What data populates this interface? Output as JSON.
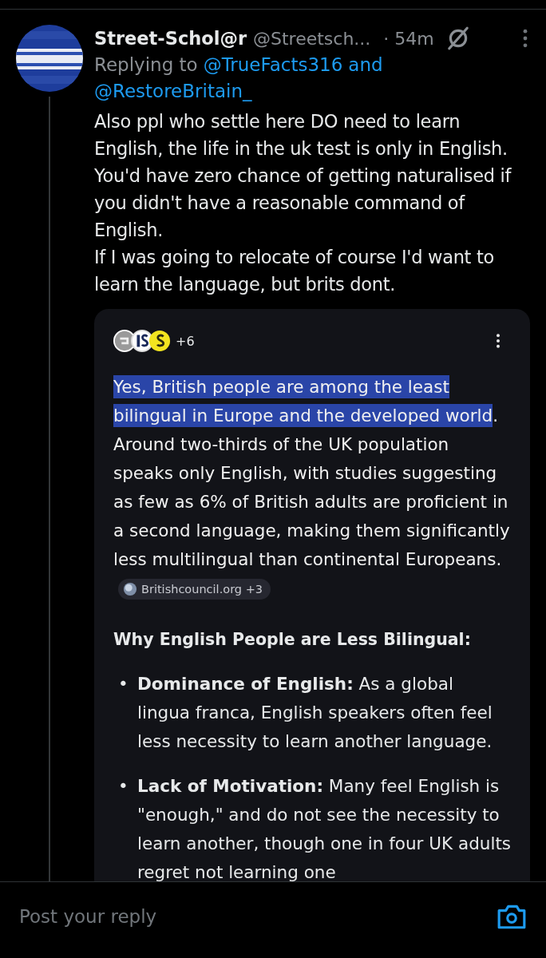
{
  "post": {
    "author": "Street-Schol@r",
    "handle": "@Streetsch...",
    "time": "· 54m",
    "replying_prefix": "Replying to",
    "replying_to": [
      "@TrueFacts316",
      "and",
      "@RestoreBritain_"
    ],
    "text": [
      "Also ppl who settle here DO need to learn English, the life in the uk test is only in English. You'd have zero chance of getting naturalised if you didn't have a reasonable command of English.",
      "If I was going to relocate of course I'd want to learn the language, but brits dont."
    ]
  },
  "answer_card": {
    "sources_more": "+6",
    "highlighted": "Yes, British people are among the least bilingual in Europe and the developed world",
    "rest": ". Around two-thirds of the UK population speaks only English, with studies suggesting as few as 6% of British adults are proficient in a second language, making them significantly less multilingual than continental Europeans.",
    "citation": "Britishcouncil.org +3",
    "heading": "Why English People are Less Bilingual:",
    "bullet_marker": "•",
    "bullets": [
      "**Dominance of English:** As a global lingua franca, English speakers often feel less necessity to learn another language.",
      "**Lack of Motivation:** Many feel English is \"enough,\" and do not see the necessity to learn another, though one in four UK adults regret not learning one"
    ]
  },
  "reply_bar": {
    "placeholder": "Post your reply"
  }
}
